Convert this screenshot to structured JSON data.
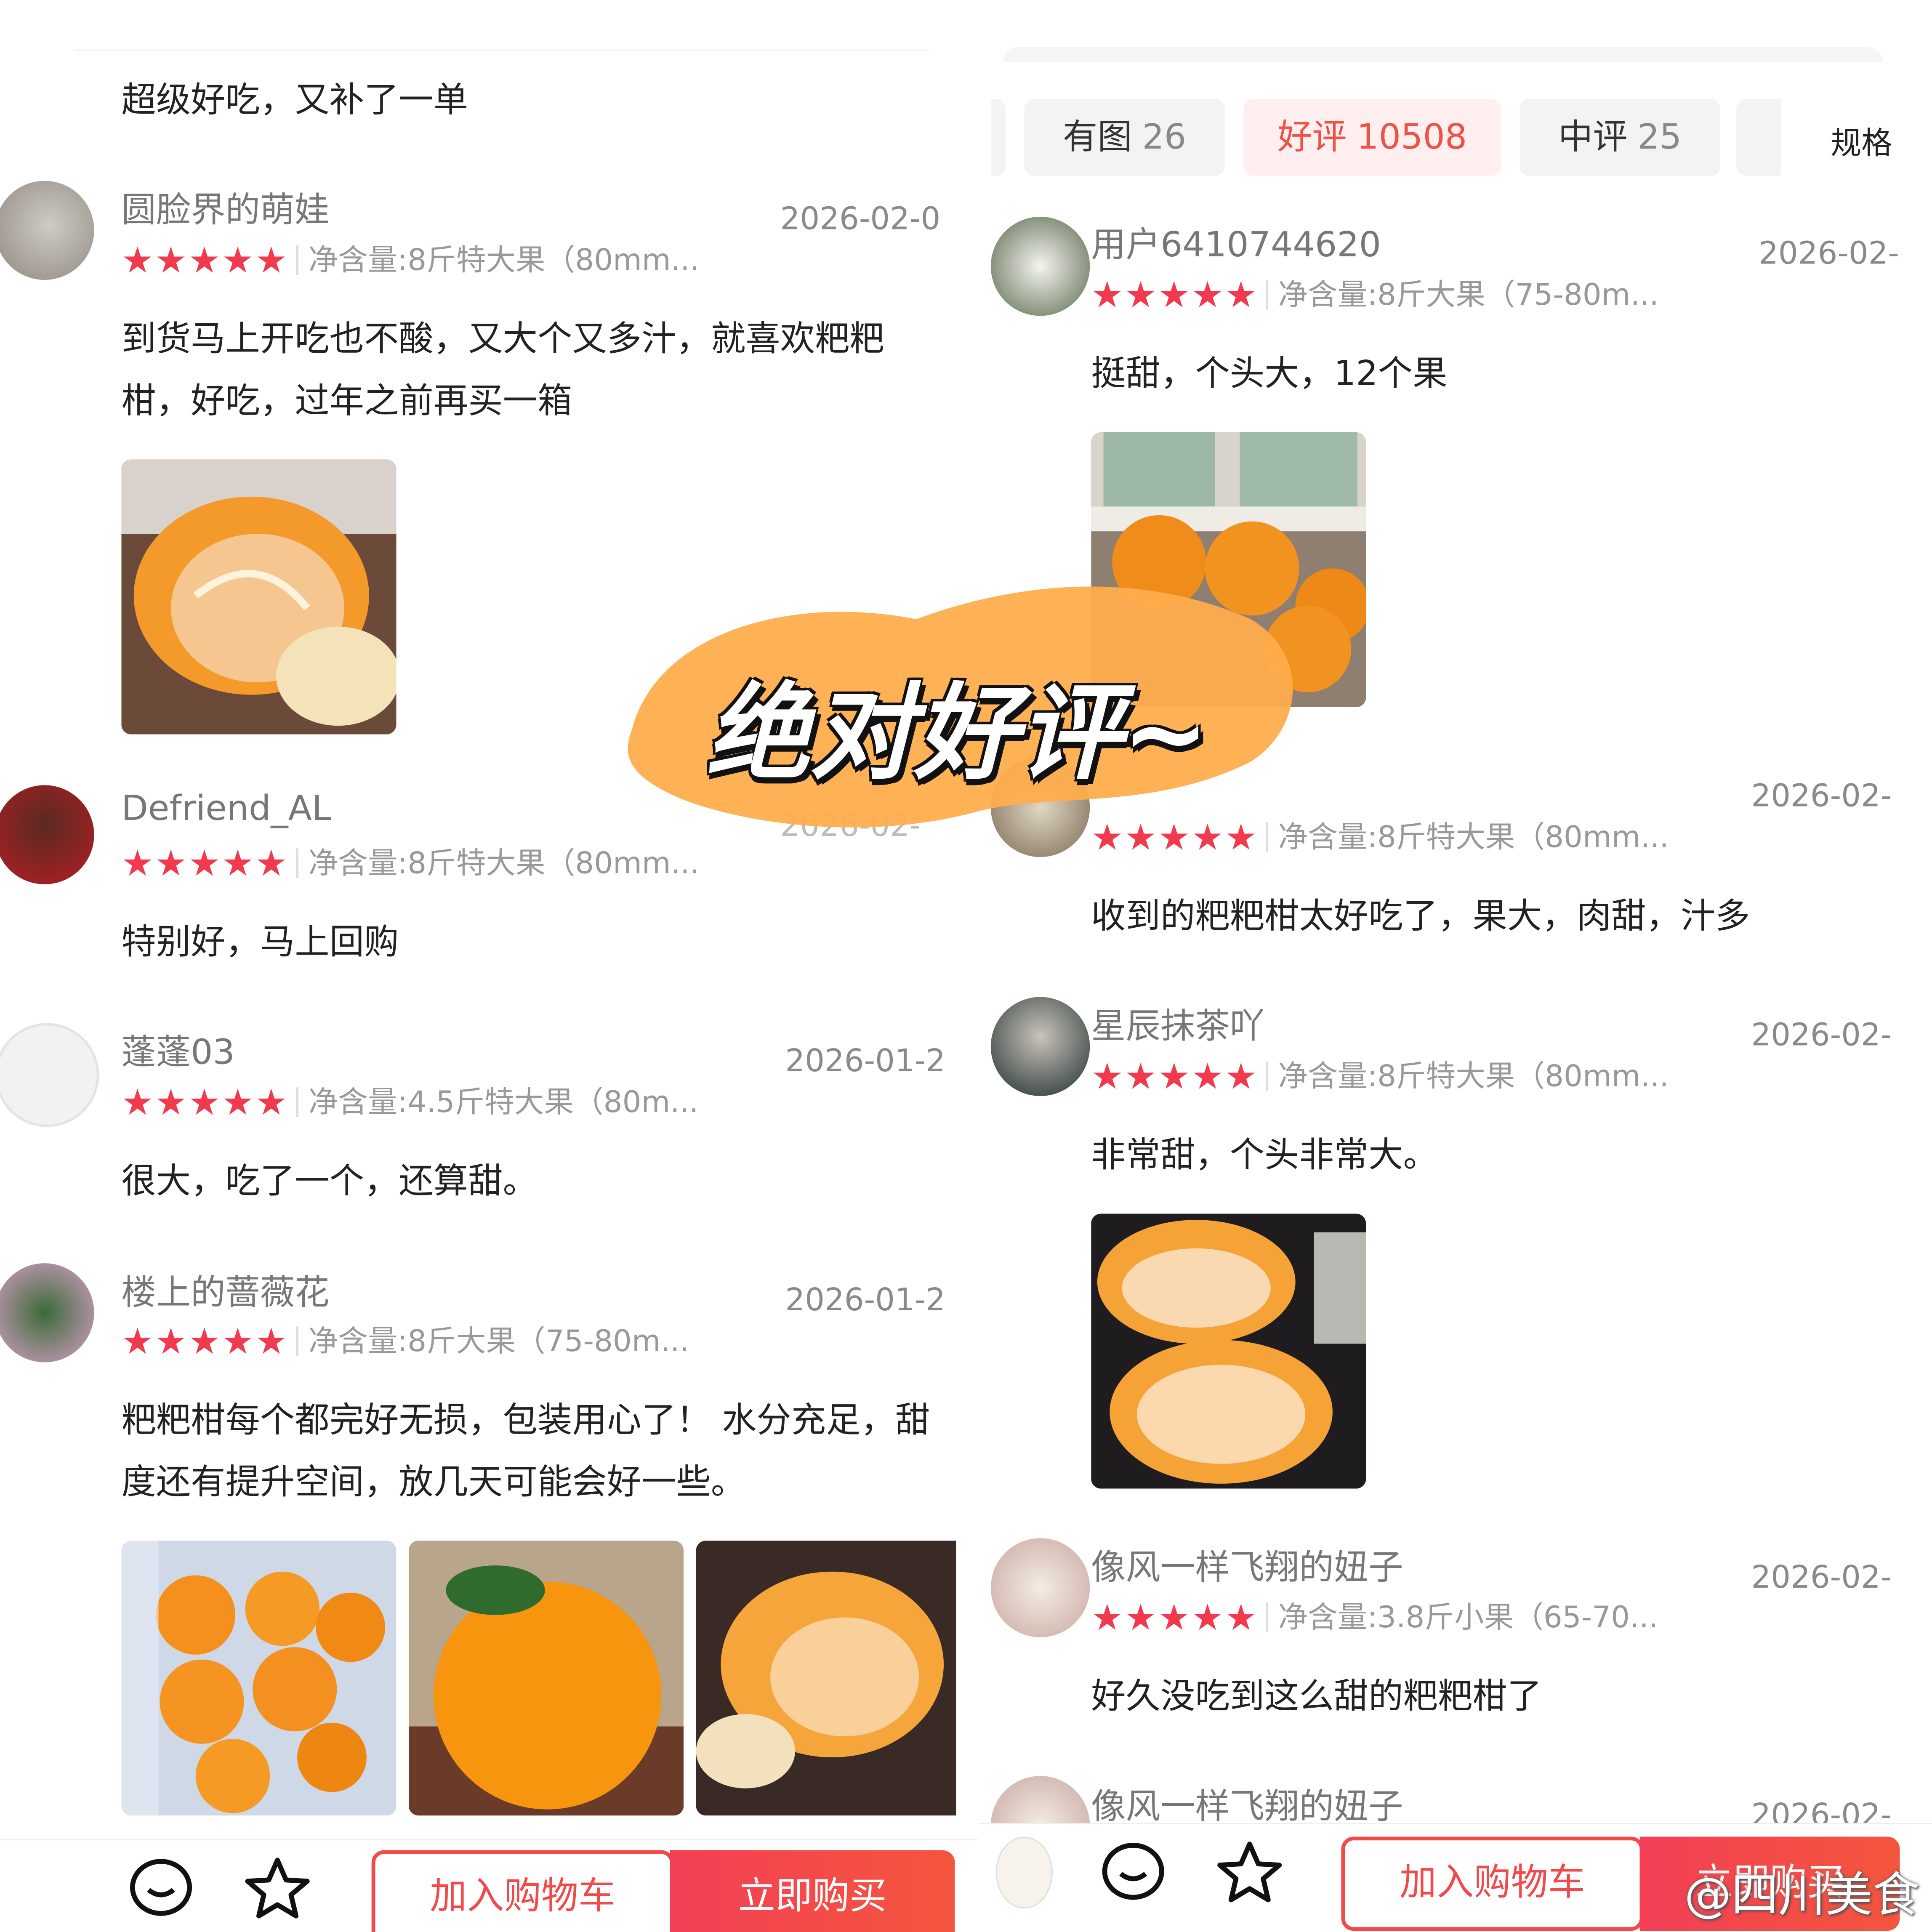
{
  "overlay": {
    "caption": "绝对好评~",
    "watermark": "@四川美食"
  },
  "left": {
    "top_snippet": "超级好吃，又补了一单",
    "reviews": [
      {
        "name": "圆脸界的萌娃",
        "date": "2026-02-0",
        "spec": "净含量:8斤特大果（80mm...",
        "lines": [
          "到货马上开吃也不酸，又大个又多汁，就喜欢粑粑",
          "柑，好吃，过年之前再买一箱"
        ],
        "rating": 5
      },
      {
        "name": "Defriend_AL",
        "date": "2026-02-",
        "spec": "净含量:8斤特大果（80mm...",
        "lines": [
          "特别好，马上回购"
        ],
        "rating": 5
      },
      {
        "name": "蓬蓬03",
        "date": "2026-01-2",
        "spec": "净含量:4.5斤特大果（80m...",
        "lines": [
          "很大，吃了一个，还算甜。"
        ],
        "rating": 5
      },
      {
        "name": "楼上的蔷薇花",
        "date": "2026-01-2",
        "spec": "净含量:8斤大果（75-80m...",
        "lines": [
          "粑粑柑每个都完好无损，包装用心了！ 水分充足，甜",
          "度还有提升空间，放几天可能会好一些。"
        ],
        "rating": 5
      }
    ],
    "bottom": {
      "cart": "加入购物车",
      "buy": "立即购买",
      "chat_icon": "chat-icon",
      "star_icon": "favorite-star-icon"
    }
  },
  "right": {
    "tabs": [
      {
        "label": "有图",
        "count": "26"
      },
      {
        "label": "好评",
        "count": "10508",
        "active": true
      },
      {
        "label": "中评",
        "count": "25"
      }
    ],
    "spec_label": "规格",
    "reviews": [
      {
        "name": "用户6410744620",
        "date": "2026-02-",
        "spec": "净含量:8斤大果（75-80m...",
        "lines": [
          "挺甜，个头大，12个果"
        ],
        "rating": 5
      },
      {
        "name": "",
        "date": "2026-02-",
        "spec": "净含量:8斤特大果（80mm...",
        "lines": [
          "收到的粑粑柑太好吃了，果大，肉甜，汁多"
        ],
        "rating": 5
      },
      {
        "name": "星辰抹茶吖",
        "date": "2026-02-",
        "spec": "净含量:8斤特大果（80mm...",
        "lines": [
          "非常甜，个头非常大。"
        ],
        "rating": 5
      },
      {
        "name": "像风一样飞翔的妞子",
        "date": "2026-02-",
        "spec": "净含量:3.8斤小果（65-70...",
        "lines": [
          "好久没吃到这么甜的粑粑柑了"
        ],
        "rating": 5
      },
      {
        "name": "像风一样飞翔的妞子",
        "date": "2026-02-",
        "spec": "",
        "lines": [],
        "rating": 0
      }
    ],
    "bottom": {
      "cart": "加入购物车",
      "buy": "立即购买",
      "chat_icon": "chat-icon",
      "star_icon": "favorite-star-icon"
    }
  },
  "colors": {
    "star": "#f23a4f",
    "accent": "#f05048",
    "overlay_brush": "#ffad4d"
  }
}
